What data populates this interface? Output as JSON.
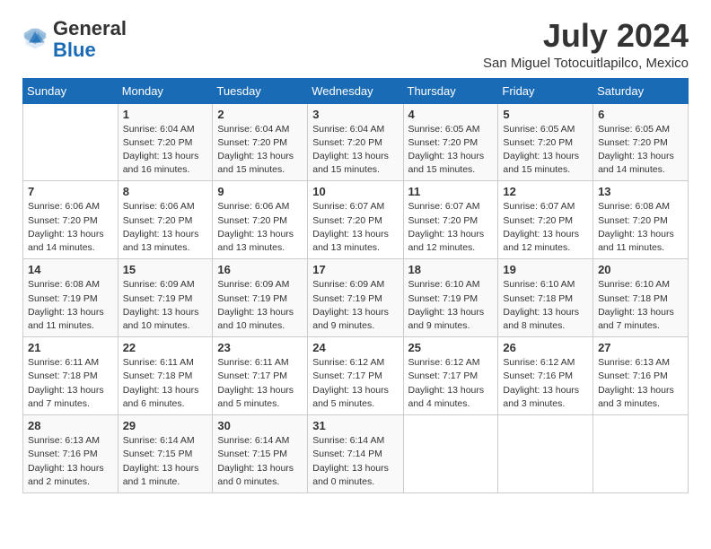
{
  "header": {
    "logo_general": "General",
    "logo_blue": "Blue",
    "month_title": "July 2024",
    "location": "San Miguel Totocuitlapilco, Mexico"
  },
  "days_of_week": [
    "Sunday",
    "Monday",
    "Tuesday",
    "Wednesday",
    "Thursday",
    "Friday",
    "Saturday"
  ],
  "weeks": [
    [
      {
        "day": "",
        "info": ""
      },
      {
        "day": "1",
        "info": "Sunrise: 6:04 AM\nSunset: 7:20 PM\nDaylight: 13 hours\nand 16 minutes."
      },
      {
        "day": "2",
        "info": "Sunrise: 6:04 AM\nSunset: 7:20 PM\nDaylight: 13 hours\nand 15 minutes."
      },
      {
        "day": "3",
        "info": "Sunrise: 6:04 AM\nSunset: 7:20 PM\nDaylight: 13 hours\nand 15 minutes."
      },
      {
        "day": "4",
        "info": "Sunrise: 6:05 AM\nSunset: 7:20 PM\nDaylight: 13 hours\nand 15 minutes."
      },
      {
        "day": "5",
        "info": "Sunrise: 6:05 AM\nSunset: 7:20 PM\nDaylight: 13 hours\nand 15 minutes."
      },
      {
        "day": "6",
        "info": "Sunrise: 6:05 AM\nSunset: 7:20 PM\nDaylight: 13 hours\nand 14 minutes."
      }
    ],
    [
      {
        "day": "7",
        "info": "Sunrise: 6:06 AM\nSunset: 7:20 PM\nDaylight: 13 hours\nand 14 minutes."
      },
      {
        "day": "8",
        "info": "Sunrise: 6:06 AM\nSunset: 7:20 PM\nDaylight: 13 hours\nand 13 minutes."
      },
      {
        "day": "9",
        "info": "Sunrise: 6:06 AM\nSunset: 7:20 PM\nDaylight: 13 hours\nand 13 minutes."
      },
      {
        "day": "10",
        "info": "Sunrise: 6:07 AM\nSunset: 7:20 PM\nDaylight: 13 hours\nand 13 minutes."
      },
      {
        "day": "11",
        "info": "Sunrise: 6:07 AM\nSunset: 7:20 PM\nDaylight: 13 hours\nand 12 minutes."
      },
      {
        "day": "12",
        "info": "Sunrise: 6:07 AM\nSunset: 7:20 PM\nDaylight: 13 hours\nand 12 minutes."
      },
      {
        "day": "13",
        "info": "Sunrise: 6:08 AM\nSunset: 7:20 PM\nDaylight: 13 hours\nand 11 minutes."
      }
    ],
    [
      {
        "day": "14",
        "info": "Sunrise: 6:08 AM\nSunset: 7:19 PM\nDaylight: 13 hours\nand 11 minutes."
      },
      {
        "day": "15",
        "info": "Sunrise: 6:09 AM\nSunset: 7:19 PM\nDaylight: 13 hours\nand 10 minutes."
      },
      {
        "day": "16",
        "info": "Sunrise: 6:09 AM\nSunset: 7:19 PM\nDaylight: 13 hours\nand 10 minutes."
      },
      {
        "day": "17",
        "info": "Sunrise: 6:09 AM\nSunset: 7:19 PM\nDaylight: 13 hours\nand 9 minutes."
      },
      {
        "day": "18",
        "info": "Sunrise: 6:10 AM\nSunset: 7:19 PM\nDaylight: 13 hours\nand 9 minutes."
      },
      {
        "day": "19",
        "info": "Sunrise: 6:10 AM\nSunset: 7:18 PM\nDaylight: 13 hours\nand 8 minutes."
      },
      {
        "day": "20",
        "info": "Sunrise: 6:10 AM\nSunset: 7:18 PM\nDaylight: 13 hours\nand 7 minutes."
      }
    ],
    [
      {
        "day": "21",
        "info": "Sunrise: 6:11 AM\nSunset: 7:18 PM\nDaylight: 13 hours\nand 7 minutes."
      },
      {
        "day": "22",
        "info": "Sunrise: 6:11 AM\nSunset: 7:18 PM\nDaylight: 13 hours\nand 6 minutes."
      },
      {
        "day": "23",
        "info": "Sunrise: 6:11 AM\nSunset: 7:17 PM\nDaylight: 13 hours\nand 5 minutes."
      },
      {
        "day": "24",
        "info": "Sunrise: 6:12 AM\nSunset: 7:17 PM\nDaylight: 13 hours\nand 5 minutes."
      },
      {
        "day": "25",
        "info": "Sunrise: 6:12 AM\nSunset: 7:17 PM\nDaylight: 13 hours\nand 4 minutes."
      },
      {
        "day": "26",
        "info": "Sunrise: 6:12 AM\nSunset: 7:16 PM\nDaylight: 13 hours\nand 3 minutes."
      },
      {
        "day": "27",
        "info": "Sunrise: 6:13 AM\nSunset: 7:16 PM\nDaylight: 13 hours\nand 3 minutes."
      }
    ],
    [
      {
        "day": "28",
        "info": "Sunrise: 6:13 AM\nSunset: 7:16 PM\nDaylight: 13 hours\nand 2 minutes."
      },
      {
        "day": "29",
        "info": "Sunrise: 6:14 AM\nSunset: 7:15 PM\nDaylight: 13 hours\nand 1 minute."
      },
      {
        "day": "30",
        "info": "Sunrise: 6:14 AM\nSunset: 7:15 PM\nDaylight: 13 hours\nand 0 minutes."
      },
      {
        "day": "31",
        "info": "Sunrise: 6:14 AM\nSunset: 7:14 PM\nDaylight: 13 hours\nand 0 minutes."
      },
      {
        "day": "",
        "info": ""
      },
      {
        "day": "",
        "info": ""
      },
      {
        "day": "",
        "info": ""
      }
    ]
  ]
}
